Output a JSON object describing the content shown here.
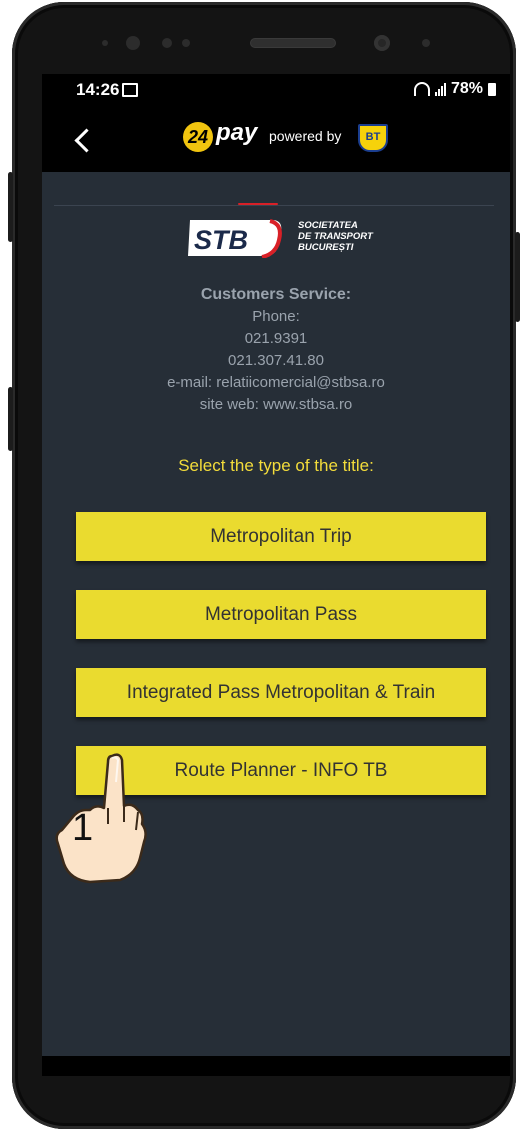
{
  "status_bar": {
    "time": "14:26",
    "battery": "78%"
  },
  "app_bar": {
    "logo_number": "24",
    "logo_word": "pay",
    "powered_by": "powered by",
    "bank_logo": "BT"
  },
  "company": {
    "logo": "STB",
    "name_lines": [
      "SOCIETATEA",
      "DE TRANSPORT",
      "BUCUREȘTI"
    ]
  },
  "contact": {
    "heading": "Customers Service:",
    "phone_label": "Phone:",
    "phone1": "021.9391",
    "phone2": "021.307.41.80",
    "email": "e-mail: relatiicomercial@stbsa.ro",
    "site": "site web: www.stbsa.ro"
  },
  "select_title": "Select the type of the title:",
  "options": [
    {
      "label": "Metropolitan Trip"
    },
    {
      "label": "Metropolitan Pass"
    },
    {
      "label": "Integrated Pass Metropolitan & Train"
    },
    {
      "label": "Route Planner - INFO TB"
    }
  ],
  "annotation": {
    "step": "1"
  },
  "colors": {
    "screen_bg": "#262e37",
    "button_bg": "#eadb2f",
    "accent_text": "#f3dc3b",
    "stb_red": "#d82027"
  }
}
